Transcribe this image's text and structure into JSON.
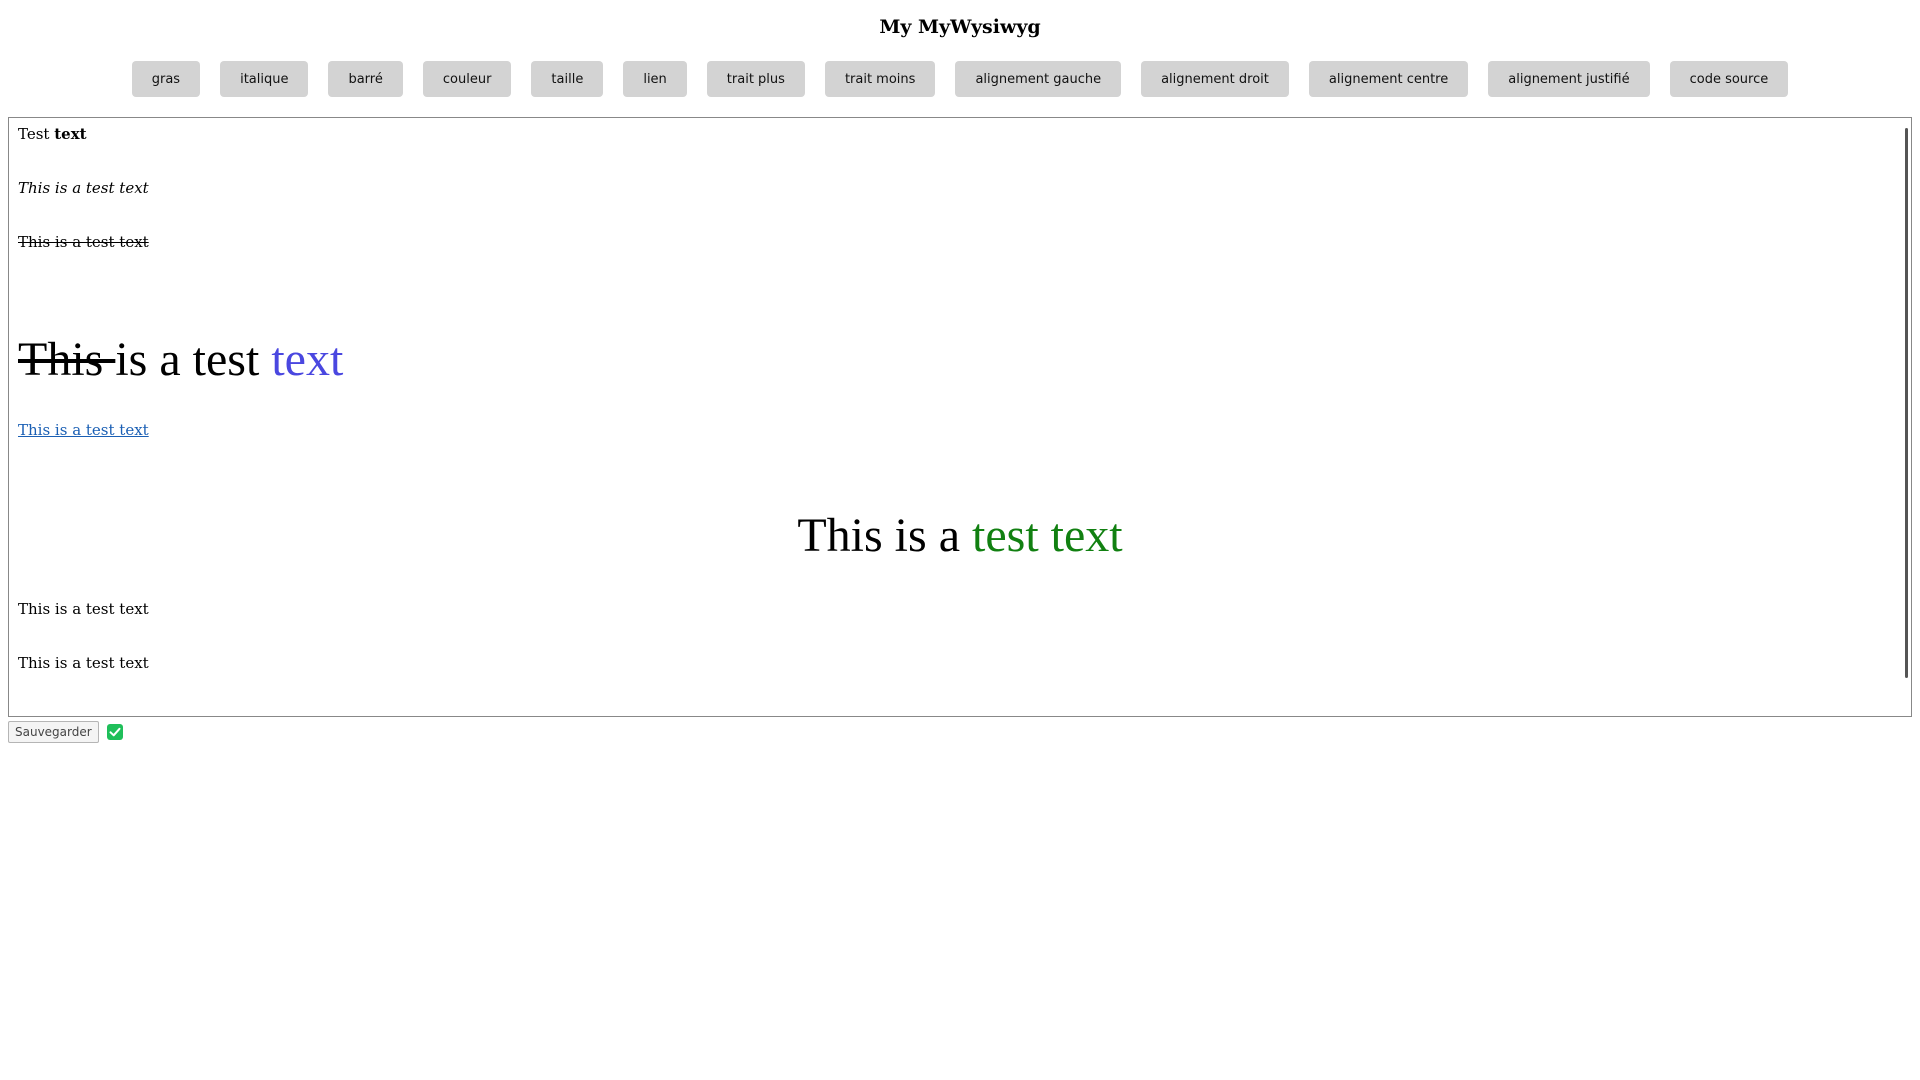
{
  "app": {
    "title": "My MyWysiwyg"
  },
  "toolbar": {
    "buttons": [
      {
        "label": "gras"
      },
      {
        "label": "italique"
      },
      {
        "label": "barré"
      },
      {
        "label": "couleur"
      },
      {
        "label": "taille"
      },
      {
        "label": "lien"
      },
      {
        "label": "trait plus"
      },
      {
        "label": "trait moins"
      },
      {
        "label": "alignement gauche"
      },
      {
        "label": "alignement droit"
      },
      {
        "label": "alignement centre"
      },
      {
        "label": "alignement justifié"
      },
      {
        "label": "code source"
      }
    ]
  },
  "editor": {
    "line1": {
      "normal": "Test ",
      "bold": "text"
    },
    "line2": "This is a test text",
    "line3": "This is a test text",
    "line4": {
      "strike": "This ",
      "normal": "is a test ",
      "colored": "text"
    },
    "line5": "This is a test text",
    "line6": {
      "normal": "This is a ",
      "colored": "test text"
    },
    "line7": "This is a test text",
    "line8": "This is a test text"
  },
  "footer": {
    "save_label": "Sauvegarder",
    "status_icon": "check-icon"
  },
  "colors": {
    "toolbar_button_bg": "#d3d3d3",
    "blue_text": "#4a47e0",
    "green_text": "#118011",
    "link": "#1a5fb4",
    "check_green": "#1fbf5a"
  }
}
